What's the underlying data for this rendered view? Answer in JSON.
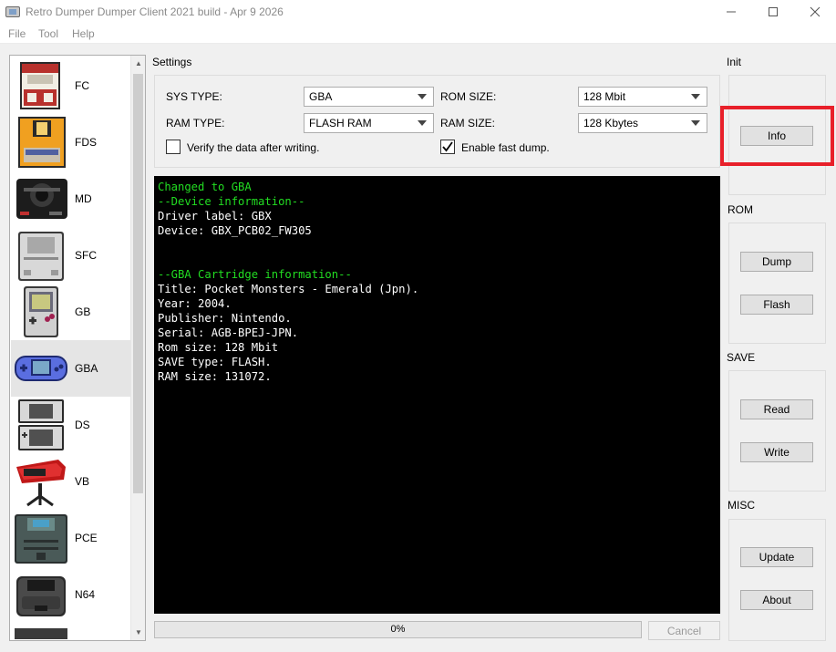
{
  "window": {
    "title": "Retro Dumper Dumper Client 2021 build - Apr  9 2026",
    "controls": [
      "minimize",
      "maximize",
      "close"
    ]
  },
  "menu": [
    "File",
    "Tool",
    "Help"
  ],
  "consoles": [
    {
      "label": "FC",
      "icon": "famicom-icon",
      "selected": false
    },
    {
      "label": "FDS",
      "icon": "famicom-disk-icon",
      "selected": false
    },
    {
      "label": "MD",
      "icon": "mega-drive-icon",
      "selected": false
    },
    {
      "label": "SFC",
      "icon": "super-famicom-icon",
      "selected": false
    },
    {
      "label": "GB",
      "icon": "game-boy-icon",
      "selected": false
    },
    {
      "label": "GBA",
      "icon": "game-boy-advance-icon",
      "selected": true
    },
    {
      "label": "DS",
      "icon": "nintendo-ds-icon",
      "selected": false
    },
    {
      "label": "VB",
      "icon": "virtual-boy-icon",
      "selected": false
    },
    {
      "label": "PCE",
      "icon": "pc-engine-icon",
      "selected": false
    },
    {
      "label": "N64",
      "icon": "nintendo-64-icon",
      "selected": false
    }
  ],
  "settings": {
    "title": "Settings",
    "sys_type_label": "SYS TYPE:",
    "sys_type_value": "GBA",
    "ram_type_label": "RAM TYPE:",
    "ram_type_value": "FLASH RAM",
    "rom_size_label": "ROM SIZE:",
    "rom_size_value": "128 Mbit",
    "ram_size_label": "RAM SIZE:",
    "ram_size_value": "128 Kbytes",
    "verify_label": "Verify the data after writing.",
    "verify_checked": false,
    "fast_dump_label": "Enable fast dump.",
    "fast_dump_checked": true
  },
  "log": {
    "lines": [
      {
        "text": "Changed to GBA",
        "color": "#22dd22"
      },
      {
        "text": "--Device information--",
        "color": "#22dd22"
      },
      {
        "text": "Driver label: GBX",
        "color": "#ffffff"
      },
      {
        "text": "Device: GBX_PCB02_FW305",
        "color": "#ffffff"
      },
      {
        "text": "",
        "color": "#ffffff"
      },
      {
        "text": "",
        "color": "#ffffff"
      },
      {
        "text": "--GBA Cartridge information--",
        "color": "#22dd22"
      },
      {
        "text": "Title: Pocket Monsters - Emerald (Jpn).",
        "color": "#ffffff"
      },
      {
        "text": "Year: 2004.",
        "color": "#ffffff"
      },
      {
        "text": "Publisher: Nintendo.",
        "color": "#ffffff"
      },
      {
        "text": "Serial: AGB-BPEJ-JPN.",
        "color": "#ffffff"
      },
      {
        "text": "Rom size: 128 Mbit",
        "color": "#ffffff"
      },
      {
        "text": "SAVE type: FLASH.",
        "color": "#ffffff"
      },
      {
        "text": "RAM size: 131072.",
        "color": "#ffffff"
      }
    ]
  },
  "progress": {
    "percent": 0,
    "label": "0%"
  },
  "cancel_label": "Cancel",
  "panels": {
    "init": {
      "title": "Init",
      "info_label": "Info"
    },
    "rom": {
      "title": "ROM",
      "dump_label": "Dump",
      "flash_label": "Flash"
    },
    "save": {
      "title": "SAVE",
      "read_label": "Read",
      "write_label": "Write"
    },
    "misc": {
      "title": "MISC",
      "update_label": "Update",
      "about_label": "About"
    }
  },
  "highlight_color": "#e8202a"
}
